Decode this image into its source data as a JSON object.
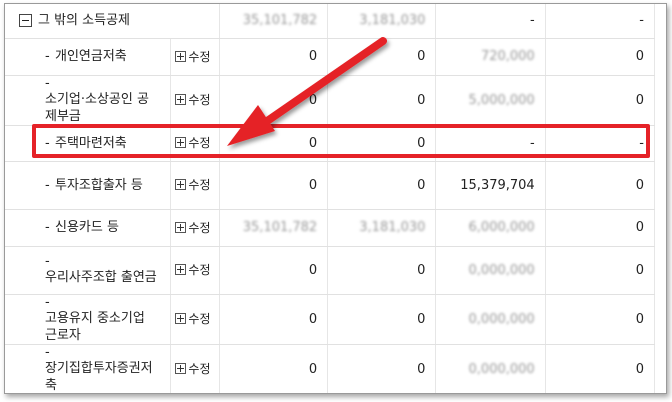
{
  "table": {
    "header_row": {
      "label": "그 밖의 소득공제",
      "c1": "35,101,782",
      "c2": "3,181,030",
      "c3": "-",
      "c4": "-"
    },
    "edit_label": "수정",
    "rows": [
      {
        "label": "개인연금저축",
        "c1": "0",
        "c2": "0",
        "c3": "720,000",
        "c4": "0",
        "c3_blurred": true
      },
      {
        "label": "소기업·소상공인 공제부금",
        "c1": "0",
        "c2": "0",
        "c3": "5,000,000",
        "c4": "0",
        "c3_blurred": true
      },
      {
        "label": "주택마련저축",
        "c1": "0",
        "c2": "0",
        "c3": "-",
        "c4": "-",
        "highlighted": true
      },
      {
        "label": "투자조합출자 등",
        "c1": "0",
        "c2": "0",
        "c3": "15,379,704",
        "c4": "0"
      },
      {
        "label": "신용카드 등",
        "c1": "35,101,782",
        "c2": "3,181,030",
        "c3": "6,000,000",
        "c4": "0",
        "c1_blurred": true,
        "c2_blurred": true,
        "c3_blurred": true
      },
      {
        "label": "우리사주조합 출연금",
        "c1": "0",
        "c2": "0",
        "c3": "0,000,000",
        "c4": "0",
        "c3_blurred": true
      },
      {
        "label": "고용유지 중소기업 근로자",
        "c1": "0",
        "c2": "0",
        "c3": "0,000,000",
        "c4": "0",
        "c3_blurred": true
      },
      {
        "label": "장기집합투자증권저축",
        "c1": "0",
        "c2": "0",
        "c3": "0,000,000",
        "c4": "0",
        "c3_blurred": true
      }
    ]
  },
  "colors": {
    "highlight": "#e52228"
  },
  "icons": {
    "collapse": "minus-box-icon",
    "edit": "plus-box-icon"
  }
}
